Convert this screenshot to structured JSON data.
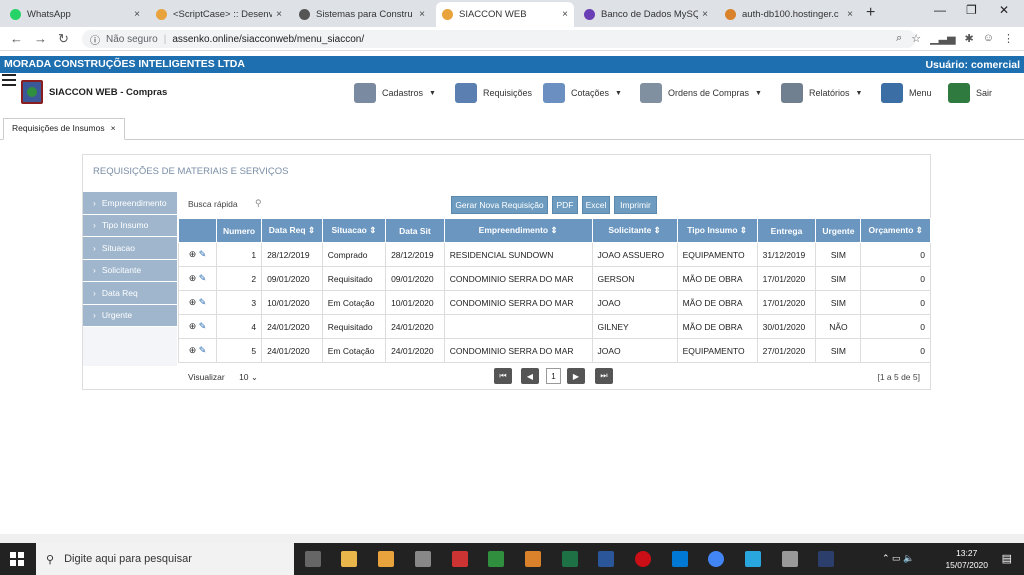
{
  "browser": {
    "tabs": [
      {
        "title": "WhatsApp",
        "color": "#25d366"
      },
      {
        "title": "<ScriptCase> :: Desenv",
        "color": "#e8a33d"
      },
      {
        "title": "Sistemas para Constru",
        "color": "#555555"
      },
      {
        "title": "SIACCON WEB",
        "color": "#e8a33d"
      },
      {
        "title": "Banco de Dados MySQL",
        "color": "#6a3fb5"
      },
      {
        "title": "auth-db100.hostinger.c",
        "color": "#d9822b"
      }
    ],
    "close_glyph": "×",
    "newtab_glyph": "+",
    "address": {
      "security": "Não seguro",
      "separator": "|",
      "url": "assenko.online/siacconweb/menu_siaccon/"
    }
  },
  "app": {
    "company": "MORADA CONSTRUÇÕES INTELIGENTES LTDA",
    "user": "Usuário: comercial",
    "brand": "SIACCON WEB - Compras",
    "menu": [
      {
        "label": "Cadastros",
        "dropdown": true,
        "color": "#7a8aa0"
      },
      {
        "label": "Requisições",
        "dropdown": false,
        "color": "#5a7fb0"
      },
      {
        "label": "Cotações",
        "dropdown": true,
        "color": "#6a8fc0"
      },
      {
        "label": "Ordens de Compras",
        "dropdown": true,
        "color": "#8090a0"
      },
      {
        "label": "Relatórios",
        "dropdown": true,
        "color": "#708090"
      },
      {
        "label": "Menu",
        "dropdown": false,
        "color": "#3a6ea5"
      },
      {
        "label": "Sair",
        "dropdown": false,
        "color": "#2f7a3e"
      }
    ],
    "page_tab": "Requisições de Insumos"
  },
  "panel": {
    "title": "REQUISIÇÕES DE MATERIAIS E SERVIÇOS",
    "filters": [
      "Empreendimento",
      "Tipo Insumo",
      "Situacao",
      "Solicitante",
      "Data Req",
      "Urgente"
    ],
    "search_placeholder": "Busca rápida",
    "buttons": [
      "Gerar Nova Requisição",
      "PDF",
      "Excel",
      "Imprimir"
    ],
    "columns": [
      "Numero",
      "Data Req ⇕",
      "Situacao ⇕",
      "Data Sit",
      "Empreendimento ⇕",
      "Solicitante ⇕",
      "Tipo Insumo ⇕",
      "Entrega",
      "Urgente",
      "Orçamento ⇕"
    ],
    "rows": [
      [
        "1",
        "28/12/2019",
        "Comprado",
        "28/12/2019",
        "RESIDENCIAL SUNDOWN",
        "JOAO ASSUERO",
        "EQUIPAMENTO",
        "31/12/2019",
        "SIM",
        "0"
      ],
      [
        "2",
        "09/01/2020",
        "Requisitado",
        "09/01/2020",
        "CONDOMINIO SERRA DO MAR",
        "GERSON",
        "MÃO DE OBRA",
        "17/01/2020",
        "SIM",
        "0"
      ],
      [
        "3",
        "10/01/2020",
        "Em Cotação",
        "10/01/2020",
        "CONDOMINIO SERRA DO MAR",
        "JOAO",
        "MÃO DE OBRA",
        "17/01/2020",
        "SIM",
        "0"
      ],
      [
        "4",
        "24/01/2020",
        "Requisitado",
        "24/01/2020",
        "",
        "GILNEY",
        "MÃO DE OBRA",
        "30/01/2020",
        "NÃO",
        "0"
      ],
      [
        "5",
        "24/01/2020",
        "Em Cotação",
        "24/01/2020",
        "CONDOMINIO SERRA DO MAR",
        "JOAO",
        "EQUIPAMENTO",
        "27/01/2020",
        "SIM",
        "0"
      ]
    ],
    "visualizar_label": "Visualizar",
    "page_size": "10",
    "current_page": "1",
    "record_count": "[1 a 5 de 5]"
  },
  "taskbar": {
    "search_placeholder": "Digite aqui para pesquisar",
    "time": "13:27",
    "date": "15/07/2020"
  }
}
